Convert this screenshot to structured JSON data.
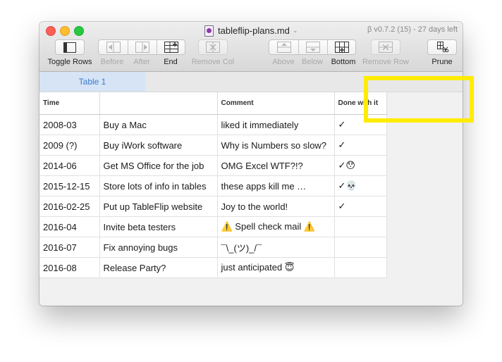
{
  "titlebar": {
    "filename": "tableflip-plans.md",
    "chevron": "⌄",
    "version": "β v0.7.2 (15) - 27 days left"
  },
  "toolbar": {
    "toggle_rows": "Toggle Rows",
    "before": "Before",
    "after": "After",
    "end": "End",
    "remove_col": "Remove Col",
    "above": "Above",
    "below": "Below",
    "bottom": "Bottom",
    "remove_row": "Remove Row",
    "prune": "Prune"
  },
  "tabs": [
    {
      "label": "Table 1",
      "active": true
    }
  ],
  "table": {
    "headers": [
      "Time",
      "",
      "Comment",
      "Done with it"
    ],
    "rows": [
      [
        "2008-03",
        "Buy a Mac",
        "liked it immediately",
        "✓"
      ],
      [
        "2009 (?)",
        "Buy iWork software",
        "Why is Numbers so slow?",
        "✓"
      ],
      [
        "2014-06",
        "Get MS Office for the job",
        "OMG Excel WTF?!?",
        "✓😯"
      ],
      [
        "2015-12-15",
        "Store lots of info in tables",
        "these apps kill me …",
        "✓💀"
      ],
      [
        "2016-02-25",
        "Put up TableFlip website",
        "Joy to the world!",
        "✓"
      ],
      [
        "2016-04",
        "Invite beta testers",
        "⚠️ Spell check mail ⚠️",
        ""
      ],
      [
        "2016-07",
        "Fix annoying bugs",
        "¯\\_(ツ)_/¯",
        ""
      ],
      [
        "2016-08",
        "Release Party?",
        "just anticipated 😇",
        ""
      ]
    ]
  },
  "colors": {
    "tab_active_bg": "#d6e4f5",
    "tab_active_text": "#3a7bd5",
    "highlight": "#ffec00"
  }
}
